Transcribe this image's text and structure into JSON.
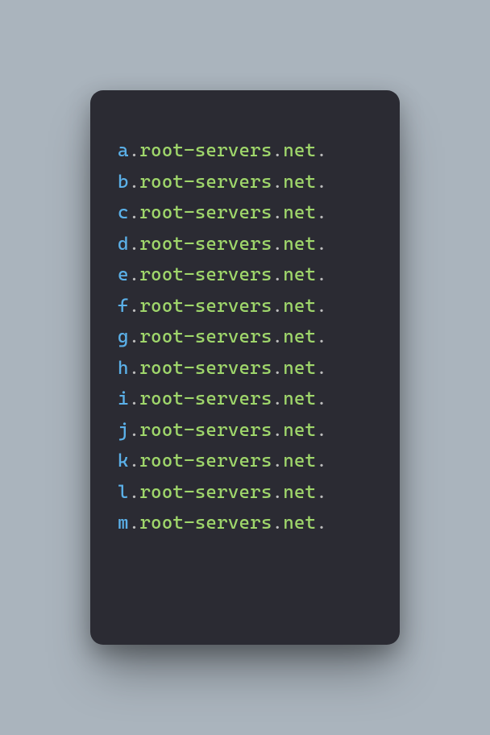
{
  "colors": {
    "background": "#aab4bd",
    "panel": "#2b2b33",
    "prefix": "#5bb0e8",
    "dot": "#bdbdbd",
    "domain": "#9fd66b"
  },
  "lines": [
    {
      "prefix": "a",
      "domain": "root-servers",
      "tld": "net"
    },
    {
      "prefix": "b",
      "domain": "root-servers",
      "tld": "net"
    },
    {
      "prefix": "c",
      "domain": "root-servers",
      "tld": "net"
    },
    {
      "prefix": "d",
      "domain": "root-servers",
      "tld": "net"
    },
    {
      "prefix": "e",
      "domain": "root-servers",
      "tld": "net"
    },
    {
      "prefix": "f",
      "domain": "root-servers",
      "tld": "net"
    },
    {
      "prefix": "g",
      "domain": "root-servers",
      "tld": "net"
    },
    {
      "prefix": "h",
      "domain": "root-servers",
      "tld": "net"
    },
    {
      "prefix": "i",
      "domain": "root-servers",
      "tld": "net"
    },
    {
      "prefix": "j",
      "domain": "root-servers",
      "tld": "net"
    },
    {
      "prefix": "k",
      "domain": "root-servers",
      "tld": "net"
    },
    {
      "prefix": "l",
      "domain": "root-servers",
      "tld": "net"
    },
    {
      "prefix": "m",
      "domain": "root-servers",
      "tld": "net"
    }
  ],
  "dot": "."
}
